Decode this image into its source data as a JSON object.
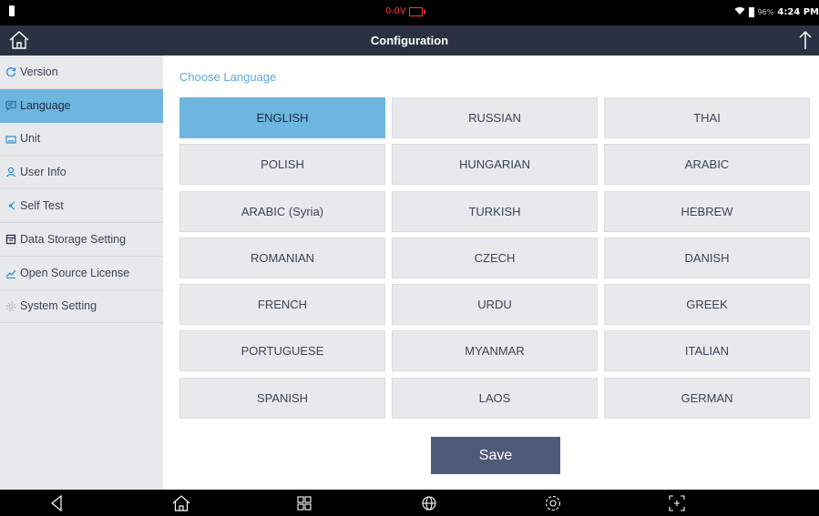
{
  "status_bar": {
    "voltage": "0.0V",
    "battery_percent": "96%",
    "time": "4:24 PM"
  },
  "header": {
    "title": "Configuration"
  },
  "sidebar": {
    "items": [
      {
        "label": "Version",
        "icon": "refresh-icon"
      },
      {
        "label": "Language",
        "icon": "chat-icon",
        "active": true
      },
      {
        "label": "Unit",
        "icon": "keyboard-icon"
      },
      {
        "label": "User Info",
        "icon": "user-icon"
      },
      {
        "label": "Self Test",
        "icon": "signal-icon"
      },
      {
        "label": "Data Storage Setting",
        "icon": "storage-icon"
      },
      {
        "label": "Open Source License",
        "icon": "license-icon"
      },
      {
        "label": "System Setting",
        "icon": "gear-icon"
      }
    ]
  },
  "main": {
    "heading": "Choose Language",
    "languages": [
      "ENGLISH",
      "RUSSIAN",
      "THAI",
      "POLISH",
      "HUNGARIAN",
      "ARABIC",
      "ARABIC (Syria)",
      "TURKISH",
      "HEBREW",
      "ROMANIAN",
      "CZECH",
      "DANISH",
      "FRENCH",
      "URDU",
      "GREEK",
      "PORTUGUESE",
      "MYANMAR",
      "ITALIAN",
      "SPANISH",
      "LAOS",
      "GERMAN"
    ],
    "selected_language": "ENGLISH",
    "save_label": "Save"
  },
  "colors": {
    "accent": "#6cb6e0",
    "header_bg": "#2b3142",
    "save_bg": "#505a78",
    "sidebar_bg": "#e8e9ec"
  }
}
